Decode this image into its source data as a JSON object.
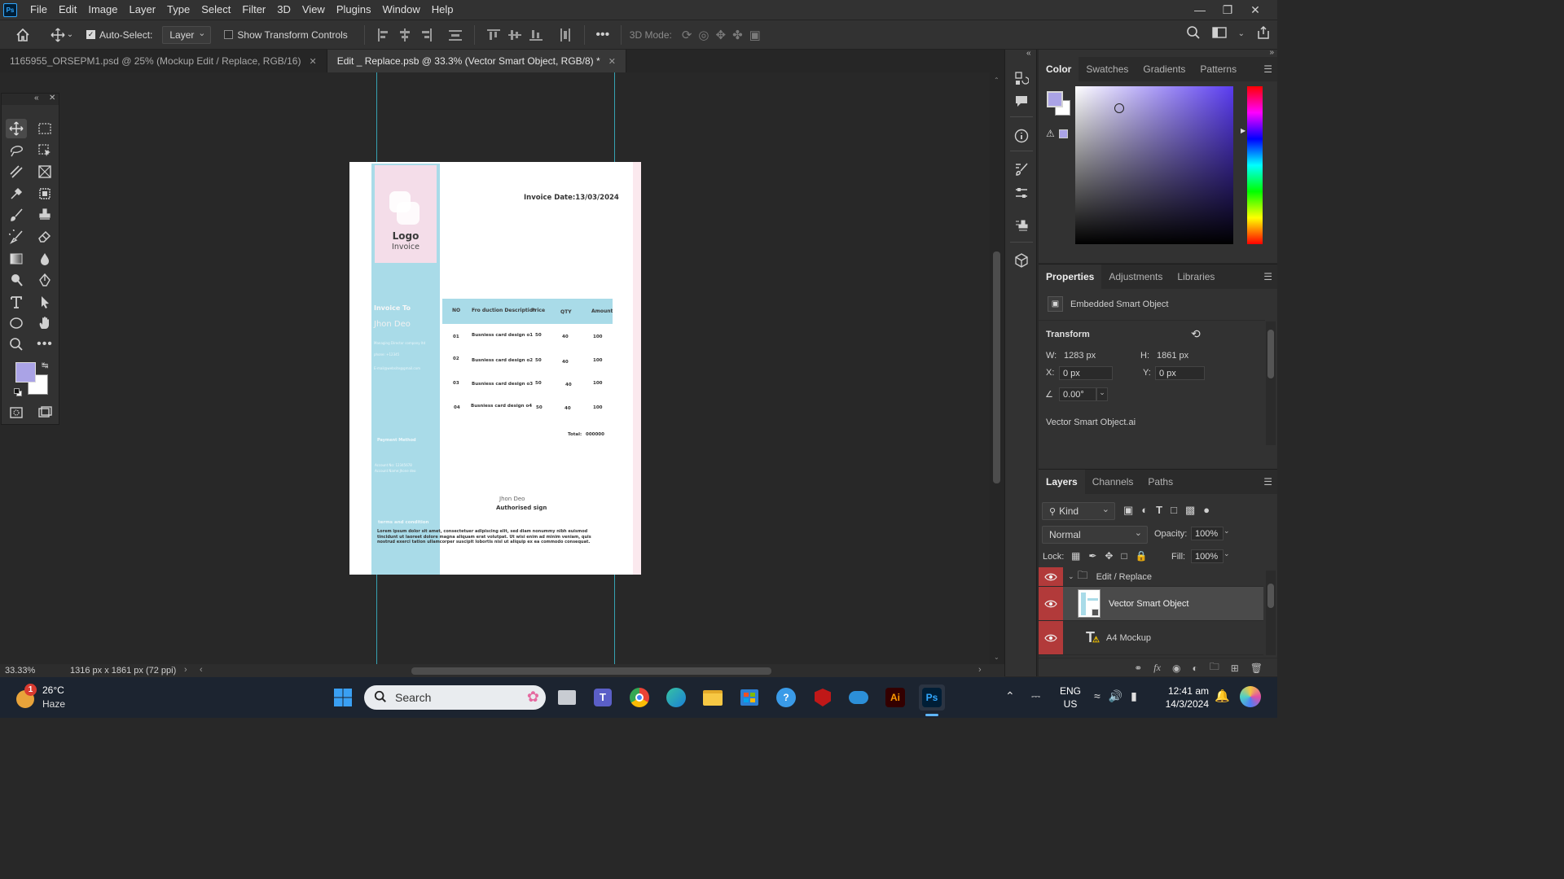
{
  "app": {
    "logo": "Ps",
    "menu": [
      "File",
      "Edit",
      "Image",
      "Layer",
      "Type",
      "Select",
      "Filter",
      "3D",
      "View",
      "Plugins",
      "Window",
      "Help"
    ]
  },
  "options": {
    "auto_select_label": "Auto-Select:",
    "auto_select_checked": true,
    "auto_select_value": "Layer",
    "show_transform_label": "Show Transform Controls",
    "mode_label": "3D Mode:"
  },
  "tabs": [
    {
      "label": "1165955_ORSEPM1.psd @ 25% (Mockup Edit / Replace, RGB/16)",
      "active": false
    },
    {
      "label": "Edit _ Replace.psb @ 33.3% (Vector Smart Object, RGB/8) *",
      "active": true
    }
  ],
  "document": {
    "logo_title": "Logo",
    "logo_sub": "Invoice",
    "invoice_date": "Invoice Date:13/03/2024",
    "invoice_to": "Invoice To",
    "client_name": "Jhon Deo",
    "client_line1": "Managing Director company ltd",
    "client_line2": "phone: +12345",
    "client_line3": "E-mail@website@gmail.com",
    "payment_method": "Payment Method",
    "account_no": "Account No: 12345678",
    "account_name": "Account Name:Jhone deo",
    "table_headers": [
      "NO",
      "Fro duction Description",
      "Price",
      "QTY",
      "Amount"
    ],
    "rows": [
      {
        "no": "01",
        "desc": "Busniess card design o1",
        "price": "50",
        "qty": "40",
        "amount": "100"
      },
      {
        "no": "02",
        "desc": "Busniess card design o2",
        "price": "50",
        "qty": "40",
        "amount": "100"
      },
      {
        "no": "03",
        "desc": "Busniess card design o3",
        "price": "50",
        "qty": "40",
        "amount": "100"
      },
      {
        "no": "04",
        "desc": "Busniess card design o4",
        "price": "50",
        "qty": "40",
        "amount": "100"
      }
    ],
    "total_label": "Total:",
    "total_value": "000000",
    "sign_name": "Jhon Deo",
    "sign_label": "Authorised sign",
    "terms_title": "terms and condition",
    "terms_text": "Lorem ipsum dolor sit amet, consectetuer adipiscing elit, sed diam nonummy nibh euismod tincidunt ut laoreet dolore magna aliquam erat volutpat. Ut wisi enim ad minim veniam, quis nostrud exerci tation ullamcorper suscipit lobortis nisl ut aliquip ex ea commodo consequat."
  },
  "color_panel": {
    "tabs": [
      "Color",
      "Swatches",
      "Gradients",
      "Patterns"
    ],
    "foreground": "#aaa3e6",
    "hue": "#5a3cf0"
  },
  "properties": {
    "tabs": [
      "Properties",
      "Adjustments",
      "Libraries"
    ],
    "type_label": "Embedded Smart Object",
    "transform_label": "Transform",
    "w_label": "W:",
    "w_value": "1283 px",
    "h_label": "H:",
    "h_value": "1861 px",
    "x_label": "X:",
    "x_value": "0 px",
    "y_label": "Y:",
    "y_value": "0 px",
    "angle_value": "0.00°",
    "file_name": "Vector Smart Object.ai"
  },
  "layers": {
    "tabs": [
      "Layers",
      "Channels",
      "Paths"
    ],
    "filter_label": "Kind",
    "blend_mode": "Normal",
    "opacity_label": "Opacity:",
    "opacity_value": "100%",
    "lock_label": "Lock:",
    "fill_label": "Fill:",
    "fill_value": "100%",
    "items": [
      {
        "name": "Edit / Replace",
        "kind": "group"
      },
      {
        "name": "Vector Smart Object",
        "kind": "smart",
        "selected": true
      },
      {
        "name": "A4 Mockup",
        "kind": "text"
      }
    ]
  },
  "status": {
    "zoom": "33.33%",
    "doc_size": "1316 px x 1861 px (72 ppi)"
  },
  "taskbar": {
    "weather_temp": "26°C",
    "weather_desc": "Haze",
    "weather_badge": "1",
    "search_label": "Search",
    "lang_line1": "ENG",
    "lang_line2": "US",
    "time": "12:41 am",
    "date": "14/3/2024"
  }
}
